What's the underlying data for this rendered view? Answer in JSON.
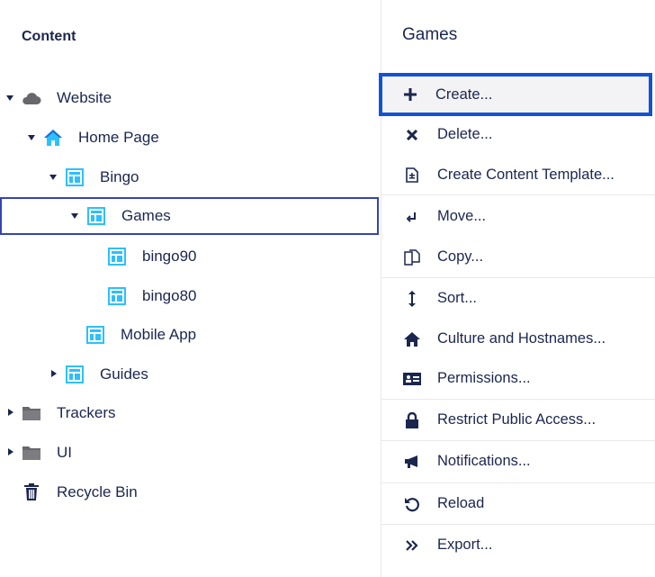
{
  "tree": {
    "title": "Content",
    "nodes": [
      {
        "label": "Website",
        "expanded": true,
        "icon": "cloud-icon"
      },
      {
        "label": "Home Page",
        "expanded": true,
        "icon": "home-icon"
      },
      {
        "label": "Bingo",
        "expanded": true,
        "icon": "document-type-icon"
      },
      {
        "label": "Games",
        "expanded": true,
        "icon": "document-type-icon",
        "selected": true
      },
      {
        "label": "bingo90",
        "icon": "document-type-icon"
      },
      {
        "label": "bingo80",
        "icon": "document-type-icon"
      },
      {
        "label": "Mobile App",
        "icon": "document-type-icon"
      },
      {
        "label": "Guides",
        "expanded": false,
        "icon": "document-type-icon"
      },
      {
        "label": "Trackers",
        "expanded": false,
        "icon": "folder-icon"
      },
      {
        "label": "UI",
        "expanded": false,
        "icon": "folder-icon"
      },
      {
        "label": "Recycle Bin",
        "icon": "trash-icon"
      }
    ]
  },
  "menu": {
    "title": "Games",
    "items": [
      {
        "label": "Create...",
        "icon": "plus-icon"
      },
      {
        "label": "Delete...",
        "icon": "close-icon"
      },
      {
        "label": "Create Content Template...",
        "icon": "template-icon"
      },
      {
        "label": "Move...",
        "icon": "move-icon"
      },
      {
        "label": "Copy...",
        "icon": "copy-icon"
      },
      {
        "label": "Sort...",
        "icon": "sort-icon"
      },
      {
        "label": "Culture and Hostnames...",
        "icon": "home-icon"
      },
      {
        "label": "Permissions...",
        "icon": "permissions-icon"
      },
      {
        "label": "Restrict Public Access...",
        "icon": "lock-icon"
      },
      {
        "label": "Notifications...",
        "icon": "megaphone-icon"
      },
      {
        "label": "Reload",
        "icon": "reload-icon"
      },
      {
        "label": "Export...",
        "icon": "export-icon"
      }
    ]
  },
  "colors": {
    "text": "#1b264f",
    "accent_blue": "#2bc0ff",
    "selection_border": "#3544b1",
    "highlight_border": "#1352d6",
    "cloud_gray": "#68676b"
  }
}
